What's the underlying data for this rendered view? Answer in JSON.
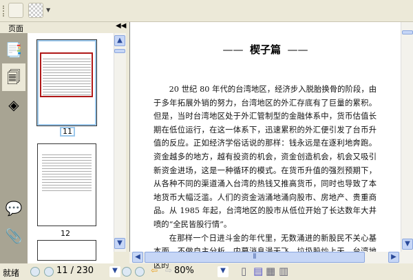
{
  "panel": {
    "title": "页面",
    "collapse_icon": "double-left-arrow"
  },
  "thumbnails": [
    {
      "label": "11",
      "selected": true
    },
    {
      "label": "12",
      "selected": false
    }
  ],
  "document": {
    "chapter_title": "楔子篇",
    "paragraphs": [
      "20 世纪 80 年代的台湾地区，经济步入脱胎换骨的阶段，由于多年拓展外销的努力，台湾地区的外汇存底有了巨量的累积。但是，当时台湾地区处于外汇管制型的金融体系中，货币估值长期在低位运行，在这一体系下，迅速累积的外汇便引发了台币升值的反应。正如经济学俗话说的那样：钱永远是在逐利地奔跑。资金越多的地方，越有投资的机会，资金创造机会，机会又吸引新资金进场，这是一种循环的模式。在货币升值的强烈预期下，从各种不同的渠道涌入台湾的热钱又推高货币，同时也导致了本地货币大幅泛滥。人们的资金汹涌地涌向股市、房地产、贵重商品。从 1985 年起，台湾地区的股市从低位开始了长达数年大井喷的“全民皆股行情”。",
      "在那样一个日进斗金的年代里，无数涌进的新股民不关心基本面，不做自主分析，内幕消息漫天飞，垃圾股炒上天。台湾地区的"
    ]
  },
  "status": {
    "text": "就绪",
    "page_value": "11 / 230",
    "zoom_value": "80%"
  }
}
